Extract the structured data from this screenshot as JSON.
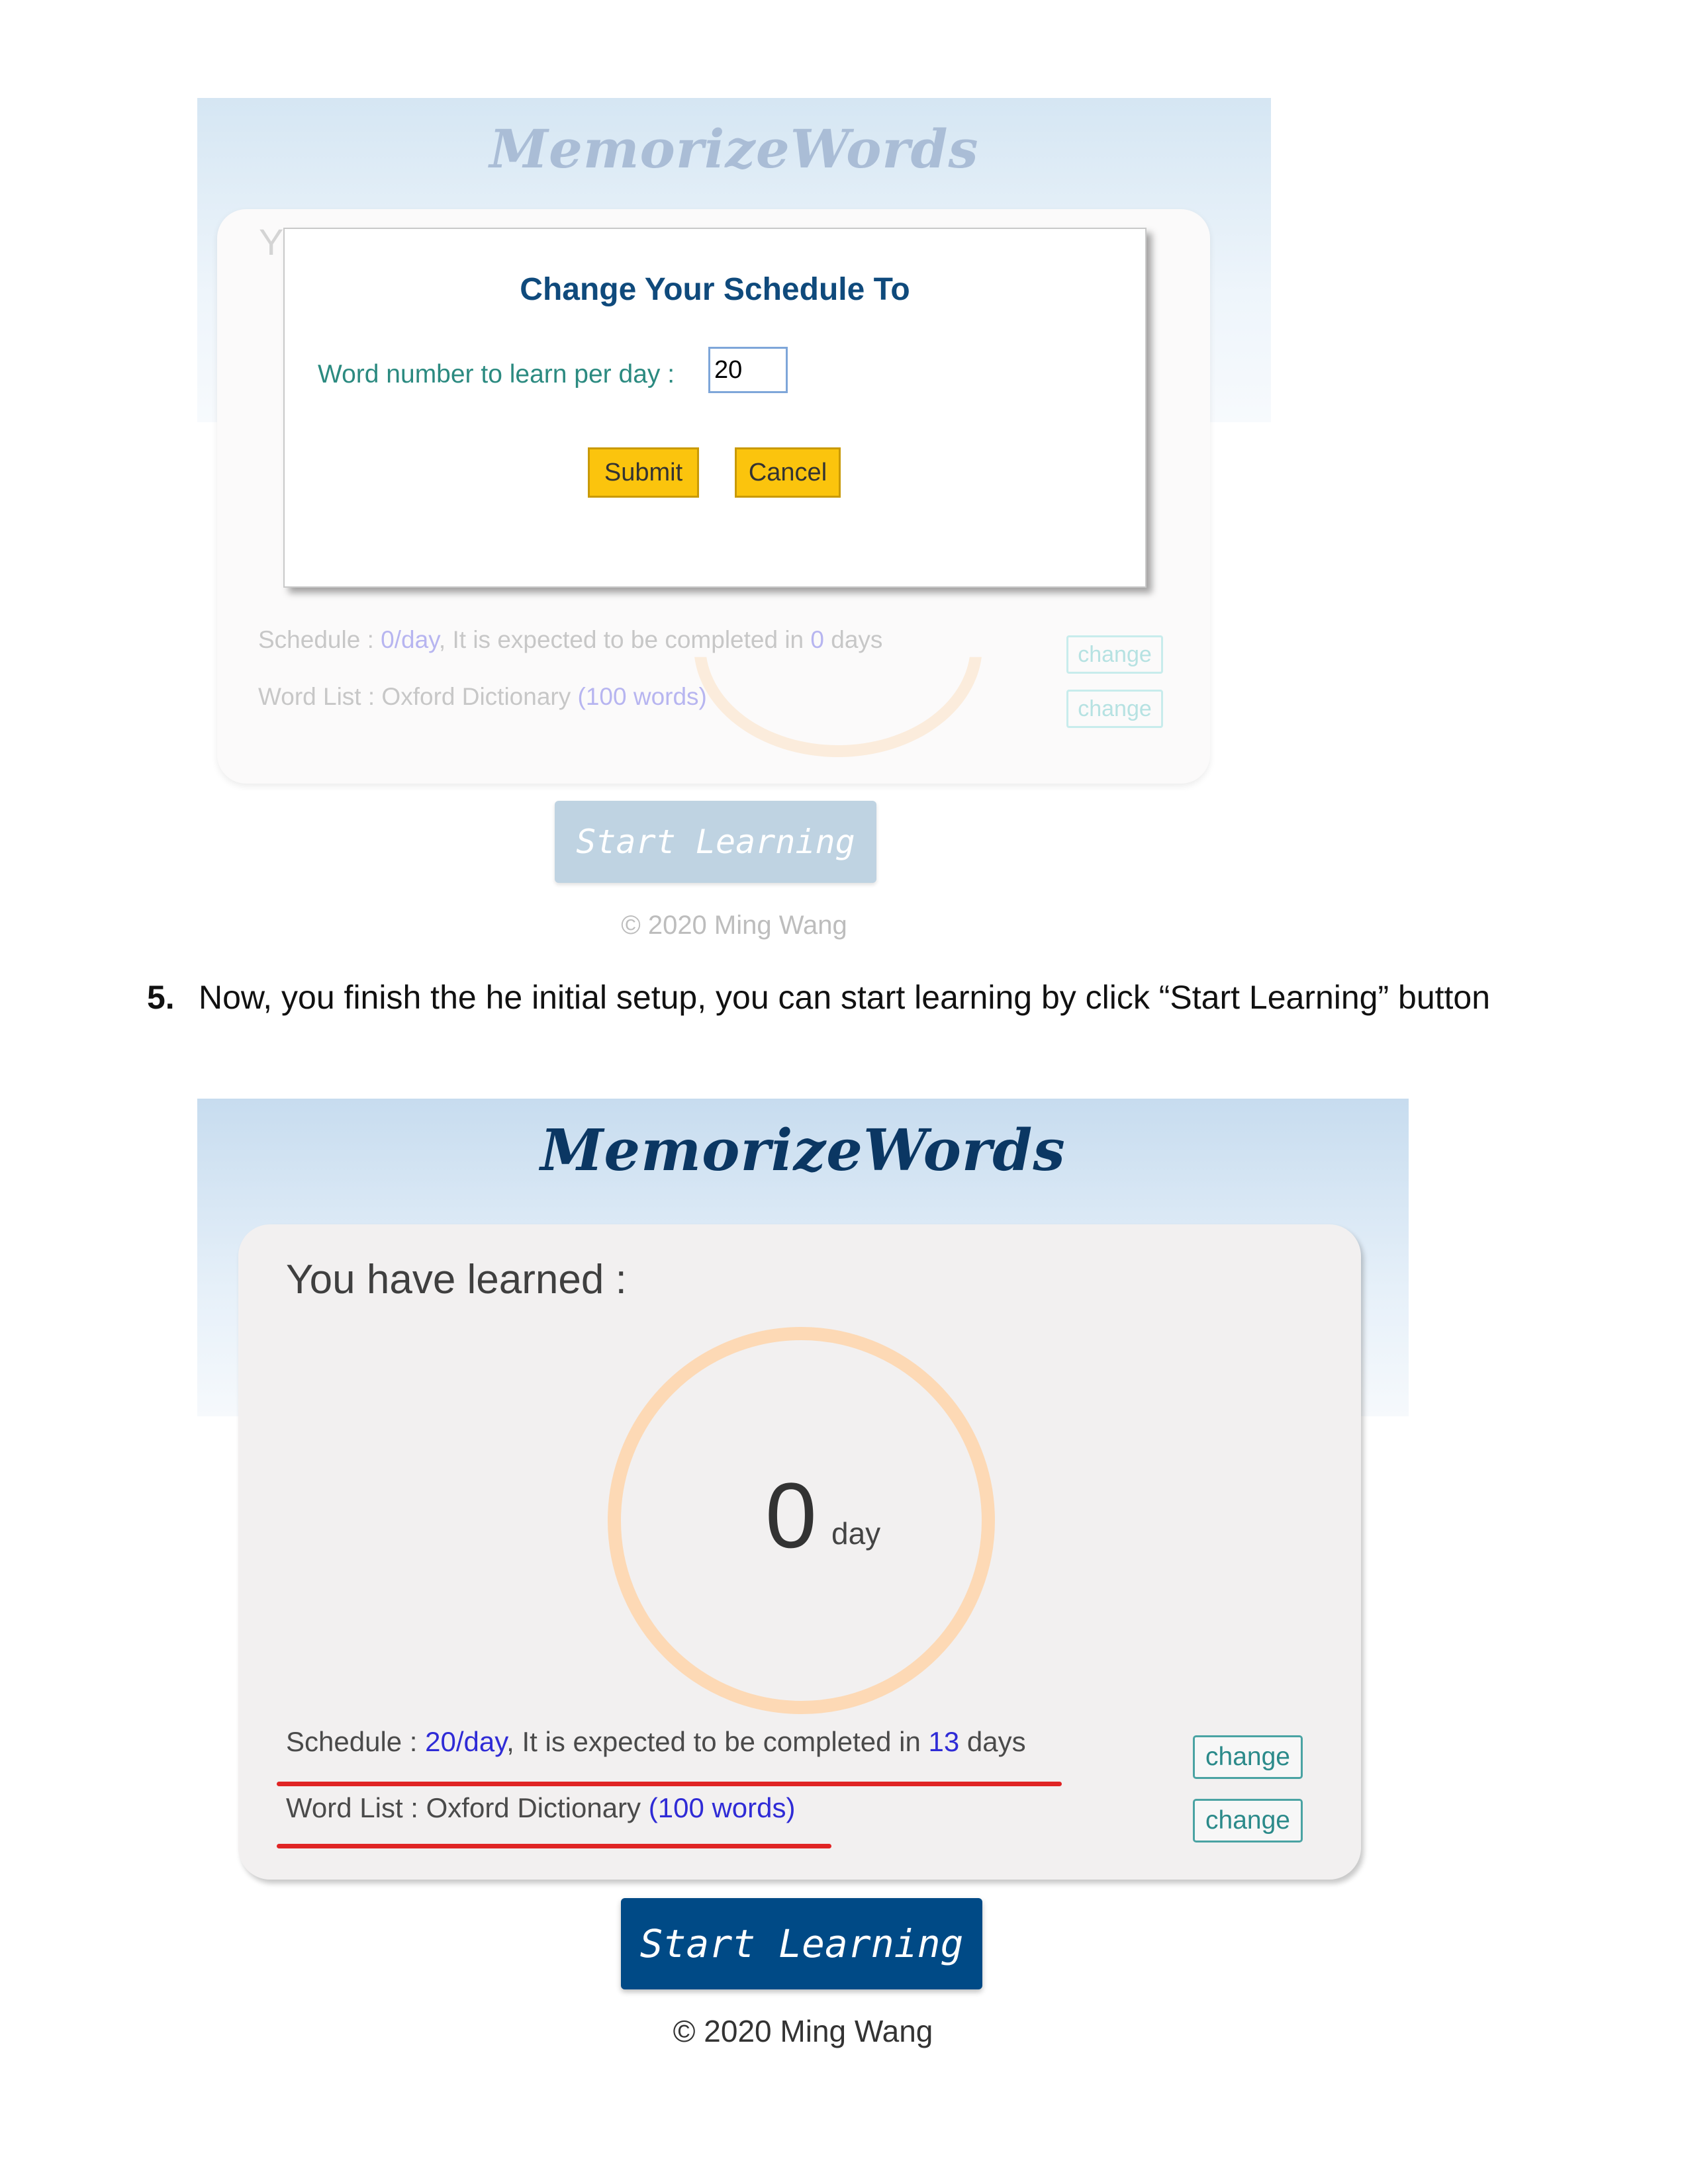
{
  "screenshot1": {
    "logo": "MemorizeWords",
    "heading_fragment": "Y(",
    "modal": {
      "title": "Change Your Schedule To",
      "field_label": "Word number to learn per day :",
      "field_value": "20",
      "submit_label": "Submit",
      "cancel_label": "Cancel"
    },
    "schedule": {
      "prefix": "Schedule : ",
      "rate": "0/day",
      "middle": ", It is expected to be completed in ",
      "days": "0",
      "suffix": " days",
      "change_label": "change"
    },
    "wordlist": {
      "prefix": "Word List : Oxford Dictionary ",
      "count": "(100 words)",
      "change_label": "change"
    },
    "start_label": "Start Learning",
    "copyright": "© 2020 Ming Wang"
  },
  "step": {
    "number": "5.",
    "text": "Now, you finish the he initial setup, you can start learning by click “Start Learning” button"
  },
  "screenshot2": {
    "logo": "MemorizeWords",
    "heading": "You have learned :",
    "progress": {
      "value": "0",
      "unit": "day"
    },
    "schedule": {
      "prefix": "Schedule : ",
      "rate": "20/day",
      "middle": ", It is expected to be completed in ",
      "days": "13",
      "suffix": " days",
      "change_label": "change"
    },
    "wordlist": {
      "prefix": "Word List : Oxford Dictionary ",
      "count": "(100 words)",
      "change_label": "change"
    },
    "start_label": "Start Learning",
    "copyright": "© 2020 Ming Wang"
  }
}
